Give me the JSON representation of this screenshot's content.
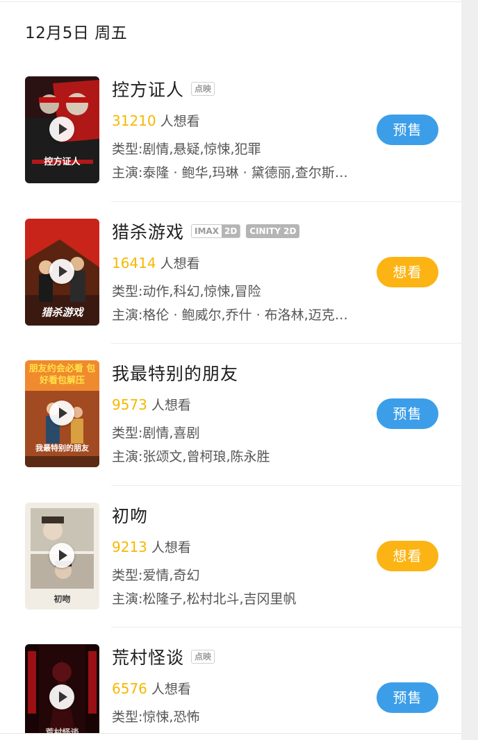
{
  "date_header": "12月5日 周五",
  "movies": [
    {
      "title": "控方证人",
      "tag": "点映",
      "want_count": "31210",
      "want_suffix": "人想看",
      "genre": "类型:剧情,悬疑,惊悚,犯罪",
      "cast": "主演:泰隆 · 鲍华,玛琳 · 黛德丽,查尔斯…",
      "button": "预售",
      "button_color": "#3c9ee8",
      "poster_text": "控方证人",
      "poster_colors": [
        "#1c1c1c",
        "#b01818"
      ]
    },
    {
      "title": "猎杀游戏",
      "tag_imax_a": "IMAX",
      "tag_imax_b": "2D",
      "tag_cinity": "CINITY 2D",
      "want_count": "16414",
      "want_suffix": "人想看",
      "genre": "类型:动作,科幻,惊悚,冒险",
      "cast": "主演:格伦 · 鲍威尔,乔什 · 布洛林,迈克…",
      "button": "想看",
      "button_color": "#fbb414",
      "poster_text": "猎杀游戏",
      "poster_colors": [
        "#c8241a",
        "#2a1a12"
      ]
    },
    {
      "title": "我最特别的朋友",
      "want_count": "9573",
      "want_suffix": "人想看",
      "genre": "类型:剧情,喜剧",
      "cast": "主演:张颂文,曾柯琅,陈永胜",
      "button": "预售",
      "button_color": "#3c9ee8",
      "poster_text": "朋友约会必看 包好看包解压",
      "poster_sub": "我最特别的朋友",
      "poster_colors": [
        "#e8742a",
        "#7a3a1e"
      ]
    },
    {
      "title": "初吻",
      "want_count": "9213",
      "want_suffix": "人想看",
      "genre": "类型:爱情,奇幻",
      "cast": "主演:松隆子,松村北斗,吉冈里帆",
      "button": "想看",
      "button_color": "#fbb414",
      "poster_text": "初吻",
      "poster_colors": [
        "#f1ede4",
        "#b9b0a2"
      ]
    },
    {
      "title": "荒村怪谈",
      "tag": "点映",
      "want_count": "6576",
      "want_suffix": "人想看",
      "genre": "类型:惊悚,恐怖",
      "cast": "",
      "button": "预售",
      "button_color": "#3c9ee8",
      "poster_text": "荒村怪谈",
      "poster_colors": [
        "#220608",
        "#6e0c10"
      ]
    }
  ]
}
